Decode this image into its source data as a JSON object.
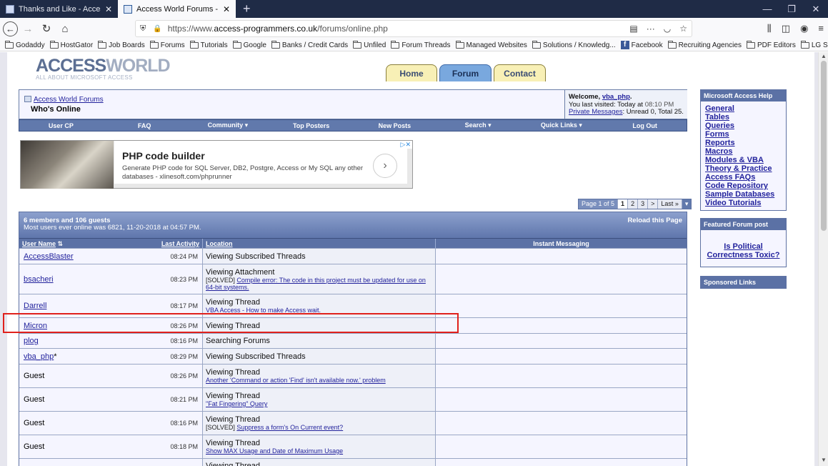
{
  "browser": {
    "tabs": [
      {
        "title": "Thanks and Like - Access World",
        "active": false
      },
      {
        "title": "Access World Forums - Who's O",
        "active": true
      }
    ],
    "url_prefix": "https://www.",
    "url_domain": "access-programmers.co.uk",
    "url_path": "/forums/online.php",
    "bookmarks": [
      "Godaddy",
      "HostGator",
      "Job Boards",
      "Forums",
      "Tutorials",
      "Google",
      "Banks / Credit Cards",
      "Unfiled",
      "Forum Threads",
      "Managed Websites",
      "Solutions / Knowledg...",
      "Facebook",
      "Recruiting Agencies",
      "PDF Editors",
      "LG Support"
    ]
  },
  "site": {
    "logo_main": "ACCESS",
    "logo_accent": "WORLD",
    "logo_tag": "ALL ABOUT MICROSOFT ACCESS",
    "top_tabs": [
      "Home",
      "Forum",
      "Contact"
    ]
  },
  "breadcrumb": {
    "root": "Access World Forums",
    "current": "Who's Online"
  },
  "welcome": {
    "greeting": "Welcome,",
    "user": "vba_php",
    "last_visit_label": "You last visited: Today at",
    "last_visit_time": "08:10 PM",
    "pm_link": "Private Messages",
    "pm_counts": ": Unread 0, Total 25."
  },
  "navbar": [
    "User CP",
    "FAQ",
    "Community ▾",
    "Top Posters",
    "New Posts",
    "Search ▾",
    "Quick Links ▾",
    "Log Out"
  ],
  "ad": {
    "headline": "PHP code builder",
    "body": "Generate PHP code for SQL Server, DB2, Postgre, Access or My SQL any other databases - xlinesoft.com/phprunner"
  },
  "pager": {
    "label": "Page 1 of 5",
    "pages": [
      "1",
      "2",
      "3"
    ],
    "next": ">",
    "last": "Last »"
  },
  "online": {
    "summary": "6 members and 106 guests",
    "record": "Most users ever online was 6821, 11-20-2018 at 04:57 PM.",
    "reload": "Reload this Page",
    "columns": [
      "User Name",
      "Last Activity",
      "Location",
      "Instant Messaging"
    ],
    "rows": [
      {
        "user": "AccessBlaster",
        "link": true,
        "time": "08:24 PM",
        "action": "Viewing Subscribed Threads",
        "prefix": "",
        "detail": ""
      },
      {
        "user": "bsacheri",
        "link": true,
        "time": "08:23 PM",
        "action": "Viewing Attachment",
        "prefix": "[SOLVED]",
        "detail": "Compile error: The code in this project must be updated for use on 64-bit systems."
      },
      {
        "user": "Darrell",
        "link": true,
        "time": "08:17 PM",
        "action": "Viewing Thread",
        "prefix": "",
        "detail": "VBA Access - How to make Access wait."
      },
      {
        "user": "Micron",
        "link": true,
        "time": "08:26 PM",
        "action": "Viewing Thread",
        "prefix": "",
        "detail": ""
      },
      {
        "user": "plog",
        "link": true,
        "time": "08:16 PM",
        "action": "Searching Forums",
        "prefix": "",
        "detail": ""
      },
      {
        "user": "vba_php",
        "link": true,
        "suffix": "*",
        "time": "08:29 PM",
        "action": "Viewing Subscribed Threads",
        "prefix": "",
        "detail": ""
      },
      {
        "user": "Guest",
        "link": false,
        "time": "08:26 PM",
        "action": "Viewing Thread",
        "prefix": "",
        "detail": "Another 'Command or action 'Find' isn't available now.' problem"
      },
      {
        "user": "Guest",
        "link": false,
        "time": "08:21 PM",
        "action": "Viewing Thread",
        "prefix": "",
        "detail": "\"Fat Fingering\" Query"
      },
      {
        "user": "Guest",
        "link": false,
        "time": "08:16 PM",
        "action": "Viewing Thread",
        "prefix": "[SOLVED]",
        "detail": "Suppress a form's On Current event?"
      },
      {
        "user": "Guest",
        "link": false,
        "time": "08:18 PM",
        "action": "Viewing Thread",
        "prefix": "",
        "detail": "Show MAX Usage and Date of Maximum Usage"
      },
      {
        "user": "",
        "link": false,
        "time": "",
        "action": "Viewing Thread",
        "prefix": "",
        "detail": ""
      }
    ]
  },
  "sidebar": {
    "help_title": "Microsoft Access Help",
    "help_links": [
      "General",
      "Tables",
      "Queries",
      "Forms",
      "Reports",
      "Macros",
      "Modules & VBA",
      "Theory & Practice",
      "Access FAQs",
      "Code Repository",
      "Sample Databases",
      "Video Tutorials"
    ],
    "featured_title": "Featured Forum post",
    "featured_link": "Is Political Correctness Toxic?",
    "sponsored_title": "Sponsored Links"
  },
  "colors": {
    "highlight": "#e0211c",
    "nav": "#6179ac",
    "link": "#22229c"
  }
}
